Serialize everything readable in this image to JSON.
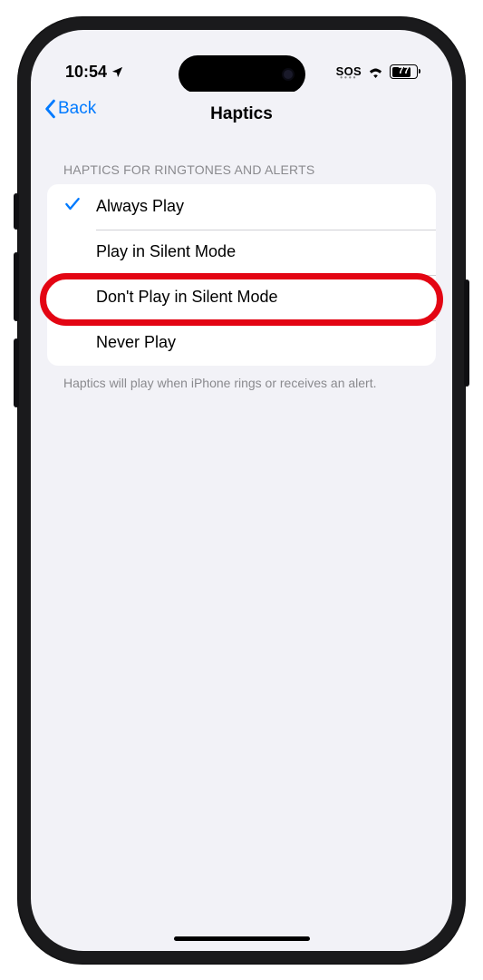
{
  "status_bar": {
    "time": "10:54",
    "sos": "SOS",
    "battery_percent": "77",
    "battery_fill_pct": 77
  },
  "navbar": {
    "back_label": "Back",
    "title": "Haptics"
  },
  "section": {
    "header": "HAPTICS FOR RINGTONES AND ALERTS",
    "footer": "Haptics will play when iPhone rings or receives an alert."
  },
  "options": {
    "0": {
      "label": "Always Play"
    },
    "1": {
      "label": "Play in Silent Mode"
    },
    "2": {
      "label": "Don't Play in Silent Mode"
    },
    "3": {
      "label": "Never Play"
    }
  },
  "selected_index": 0,
  "highlight_index": 2
}
